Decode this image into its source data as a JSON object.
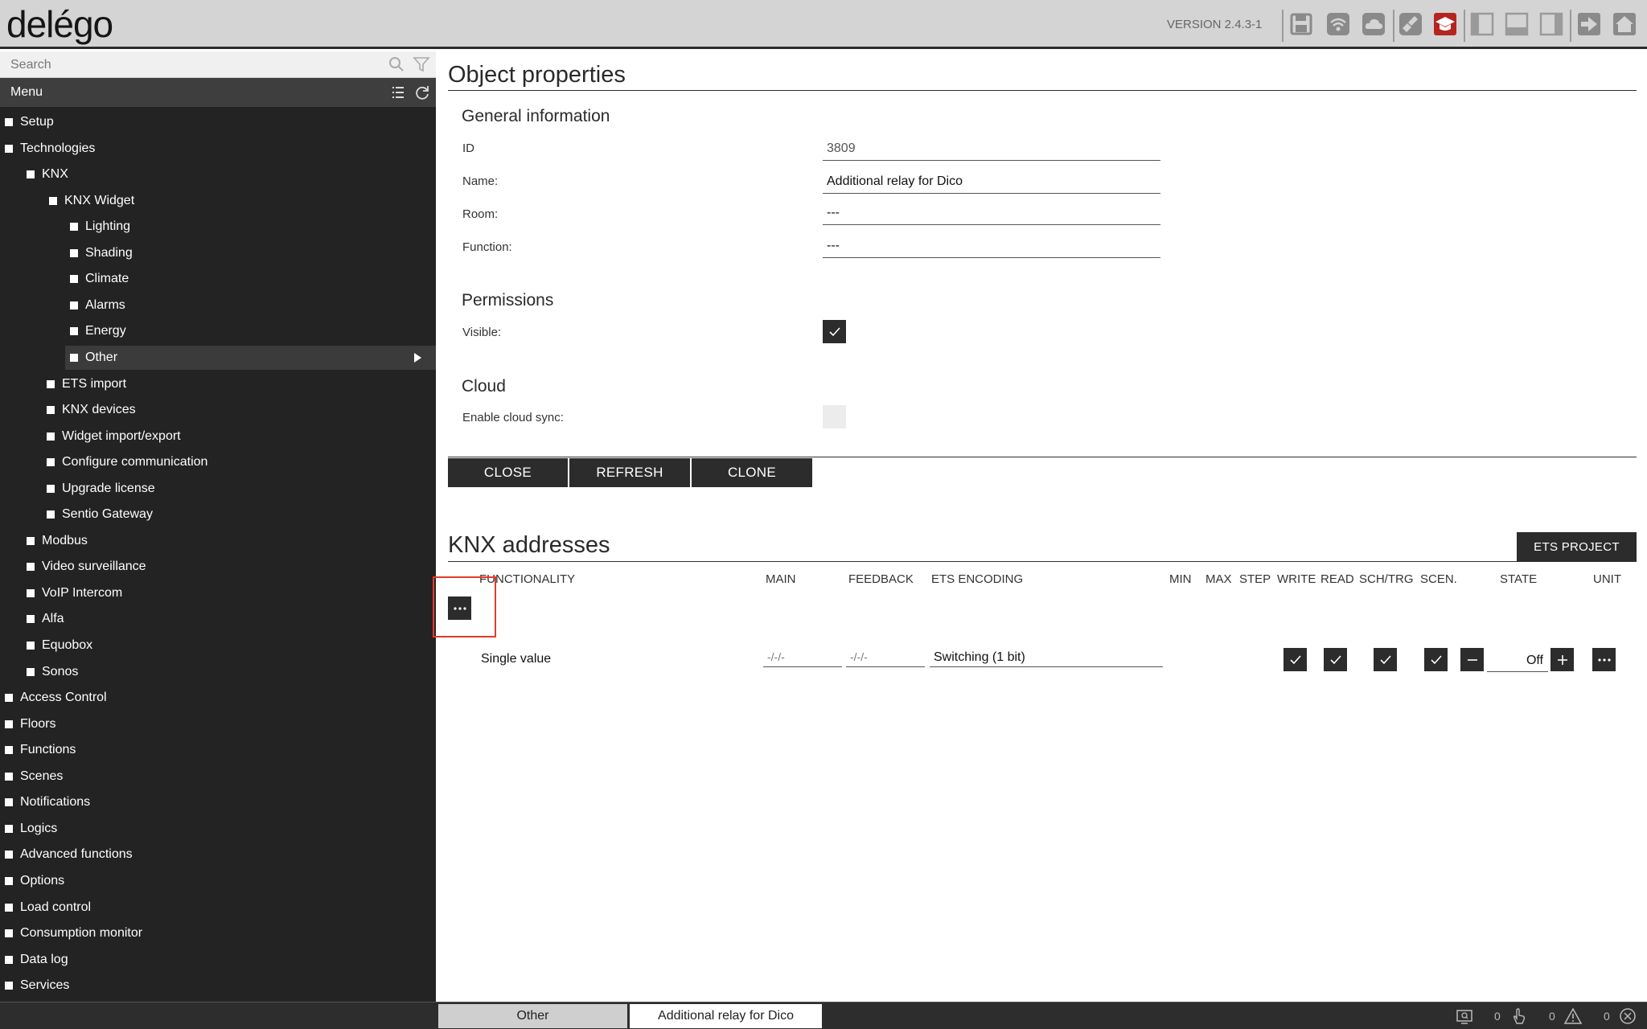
{
  "app": {
    "logo": "delégo",
    "version": "VERSION 2.4.3-1"
  },
  "toolbar": {
    "icons": [
      "save-icon",
      "wifi-icon",
      "cloud-icon",
      "broom-icon",
      "graduation-cap-icon",
      "panel-left-icon",
      "panel-bottom-icon",
      "panel-right-icon",
      "logout-icon",
      "home-icon"
    ]
  },
  "sidebar": {
    "search_placeholder": "Search",
    "menu_title": "Menu",
    "items": [
      {
        "label": "Setup",
        "level": 0
      },
      {
        "label": "Technologies",
        "level": 0
      },
      {
        "label": "KNX",
        "level": 1
      },
      {
        "label": "KNX Widget",
        "level": 2
      },
      {
        "label": "Lighting",
        "level": 3
      },
      {
        "label": "Shading",
        "level": 3
      },
      {
        "label": "Climate",
        "level": 3
      },
      {
        "label": "Alarms",
        "level": 3
      },
      {
        "label": "Energy",
        "level": 3
      },
      {
        "label": "Other",
        "level": 3,
        "selected": true
      },
      {
        "label": "ETS import",
        "level": 2
      },
      {
        "label": "KNX devices",
        "level": 2
      },
      {
        "label": "Widget import/export",
        "level": 2
      },
      {
        "label": "Configure communication",
        "level": 2
      },
      {
        "label": "Upgrade license",
        "level": 2
      },
      {
        "label": "Sentio Gateway",
        "level": 2
      },
      {
        "label": "Modbus",
        "level": 1
      },
      {
        "label": "Video surveillance",
        "level": 1
      },
      {
        "label": "VoIP Intercom",
        "level": 1
      },
      {
        "label": "Alfa",
        "level": 1
      },
      {
        "label": "Equobox",
        "level": 1
      },
      {
        "label": "Sonos",
        "level": 1
      },
      {
        "label": "Access Control",
        "level": 0
      },
      {
        "label": "Floors",
        "level": 0
      },
      {
        "label": "Functions",
        "level": 0
      },
      {
        "label": "Scenes",
        "level": 0
      },
      {
        "label": "Notifications",
        "level": 0
      },
      {
        "label": "Logics",
        "level": 0
      },
      {
        "label": "Advanced functions",
        "level": 0
      },
      {
        "label": "Options",
        "level": 0
      },
      {
        "label": "Load control",
        "level": 0
      },
      {
        "label": "Consumption monitor",
        "level": 0
      },
      {
        "label": "Data log",
        "level": 0
      },
      {
        "label": "Services",
        "level": 0
      }
    ]
  },
  "object_properties": {
    "title": "Object properties",
    "general": {
      "heading": "General information",
      "id_label": "ID",
      "id_value": "3809",
      "name_label": "Name:",
      "name_value": "Additional relay for Dico",
      "room_label": "Room:",
      "room_value": "---",
      "function_label": "Function:",
      "function_value": "---"
    },
    "permissions": {
      "heading": "Permissions",
      "visible_label": "Visible:",
      "visible_checked": true
    },
    "cloud": {
      "heading": "Cloud",
      "sync_label": "Enable cloud sync:",
      "sync_checked": false
    },
    "buttons": {
      "close": "CLOSE",
      "refresh": "REFRESH",
      "clone": "CLONE"
    }
  },
  "knx": {
    "title": "KNX addresses",
    "ets_button": "ETS PROJECT",
    "columns": {
      "functionality": "FUNCTIONALITY",
      "main": "MAIN",
      "feedback": "FEEDBACK",
      "ets_encoding": "ETS ENCODING",
      "min": "MIN",
      "max": "MAX",
      "step": "STEP",
      "write": "WRITE",
      "read": "READ",
      "sch_trg": "SCH/TRG",
      "scen": "SCEN.",
      "state": "STATE",
      "unit": "UNIT"
    },
    "row": {
      "functionality": "Single value",
      "main_placeholder": "-/-/-",
      "feedback_placeholder": "-/-/-",
      "encoding": "Switching (1 bit)",
      "write": true,
      "read": true,
      "sch_trg": true,
      "scen": true,
      "state": "Off"
    }
  },
  "statusbar": {
    "tab_other": "Other",
    "tab_active": "Additional relay for Dico",
    "count_a": "0",
    "count_b": "0",
    "count_c": "0"
  }
}
